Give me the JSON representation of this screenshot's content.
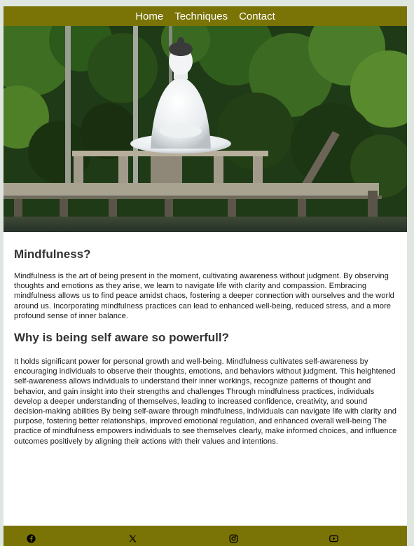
{
  "nav": {
    "items": [
      {
        "label": "Home"
      },
      {
        "label": "Techniques"
      },
      {
        "label": "Contact"
      }
    ]
  },
  "hero": {
    "image": "buddha-statue-lake-photo"
  },
  "sections": [
    {
      "heading": "Mindfulness?",
      "body": "Mindfulness is the art of being present in the moment, cultivating awareness without judgment. By observing thoughts and emotions as they arise, we learn to navigate life with clarity and compassion. Embracing mindfulness allows us to find peace amidst chaos, fostering a deeper connection with ourselves and the world around us. Incorporating mindfulness practices can lead to enhanced well-being, reduced stress, and a more profound sense of inner balance."
    },
    {
      "heading": "Why is being self aware so powerfull?",
      "body": "It holds significant power for personal growth and well-being. Mindfulness cultivates self-awareness by encouraging individuals to observe their thoughts, emotions, and behaviors without judgment. This heightened self-awareness allows individuals to understand their inner workings, recognize patterns of thought and behavior, and gain insight into their strengths and challenges Through mindfulness practices, individuals develop a deeper understanding of themselves, leading to increased confidence, creativity, and sound decision-making abilities By being self-aware through mindfulness, individuals can navigate life with clarity and purpose, fostering better relationships, improved emotional regulation, and enhanced overall well-being The practice of mindfulness empowers individuals to see themselves clearly, make informed choices, and influence outcomes positively by aligning their actions with their values and intentions."
    }
  ],
  "footer": {
    "icons": [
      "facebook-icon",
      "x-twitter-icon",
      "instagram-icon",
      "youtube-icon"
    ]
  },
  "colors": {
    "accent": "#7a7305",
    "page_background": "#dfe6df",
    "heading": "#333333"
  }
}
